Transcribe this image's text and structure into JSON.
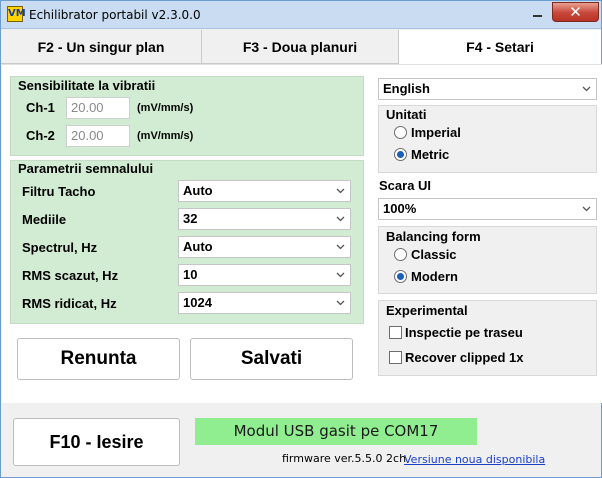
{
  "window": {
    "title": "Echilibrator portabil v2.3.0.0",
    "app_icon": "VM",
    "close_glyph": "✕"
  },
  "tabs": [
    {
      "label": "F2 - Un singur plan",
      "active": false
    },
    {
      "label": "F3 - Doua planuri",
      "active": false
    },
    {
      "label": "F4 - Setari",
      "active": true
    }
  ],
  "sensitivity": {
    "title": "Sensibilitate la vibratii",
    "channels": [
      {
        "label": "Ch-1",
        "value": "20.00",
        "unit": "(mV/mm/s)"
      },
      {
        "label": "Ch-2",
        "value": "20.00",
        "unit": "(mV/mm/s)"
      }
    ]
  },
  "signal_params": {
    "title": "Parametrii semnalului",
    "rows": [
      {
        "label": "Filtru Tacho",
        "value": "Auto"
      },
      {
        "label": "Mediile",
        "value": "32"
      },
      {
        "label": "Spectrul, Hz",
        "value": "Auto"
      },
      {
        "label": "RMS scazut, Hz",
        "value": "10"
      },
      {
        "label": "RMS ridicat, Hz",
        "value": "1024"
      }
    ]
  },
  "language": {
    "value": "English"
  },
  "units": {
    "title": "Unitati",
    "options": [
      {
        "label": "Imperial",
        "selected": false
      },
      {
        "label": "Metric",
        "selected": true
      }
    ]
  },
  "ui_scale": {
    "label": "Scara UI",
    "value": "100%"
  },
  "balancing_form": {
    "title": "Balancing form",
    "options": [
      {
        "label": "Classic",
        "selected": false
      },
      {
        "label": "Modern",
        "selected": true
      }
    ]
  },
  "experimental": {
    "title": "Experimental",
    "options": [
      {
        "label": "Inspectie pe traseu",
        "checked": false
      },
      {
        "label": "Recover clipped 1x",
        "checked": false
      }
    ]
  },
  "buttons": {
    "cancel": "Renunta",
    "save": "Salvati",
    "exit": "F10 - Iesire"
  },
  "status": {
    "message": "Modul USB gasit pe COM17",
    "firmware": "firmware ver.5.5.0 2ch",
    "update_link": "Versiune noua disponibila"
  },
  "colors": {
    "panel_green": "#d2ecd3",
    "status_green": "#90ee90",
    "radio_dot": "#1a5fb8",
    "link": "#1a40c8"
  }
}
